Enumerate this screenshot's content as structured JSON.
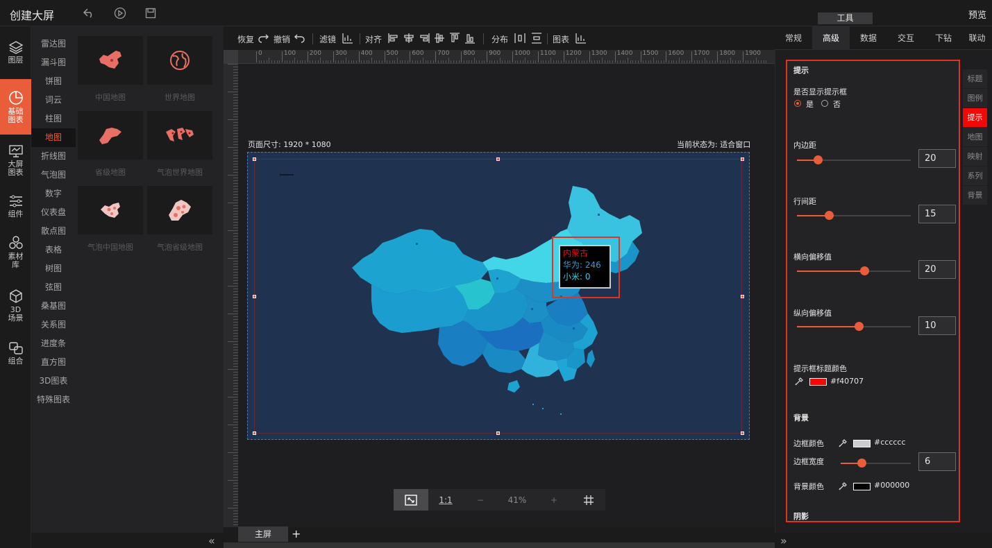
{
  "app": {
    "title": "创建大屏",
    "preview": "预览",
    "tools_label": "工具"
  },
  "iconbar": [
    {
      "label": "图层"
    },
    {
      "label": "基础\n图表"
    },
    {
      "label": "大屏\n图表"
    },
    {
      "label": "组件"
    },
    {
      "label": "素材\n库"
    },
    {
      "label": "3D\n场景"
    },
    {
      "label": "组合"
    }
  ],
  "categories": [
    "雷达图",
    "漏斗图",
    "饼图",
    "词云",
    "柱图",
    "地图",
    "折线图",
    "气泡图",
    "数字",
    "仪表盘",
    "散点图",
    "表格",
    "树图",
    "弦图",
    "桑基图",
    "关系图",
    "进度条",
    "直方图",
    "3D图表",
    "特殊图表"
  ],
  "active_category": "地图",
  "thumbs": [
    {
      "label": "中国地图"
    },
    {
      "label": "世界地图"
    },
    {
      "label": "省级地图"
    },
    {
      "label": "气泡世界地图"
    },
    {
      "label": "气泡中国地图"
    },
    {
      "label": "气泡省级地图"
    }
  ],
  "toolbar": {
    "restore": "恢复",
    "undo": "撤销",
    "filter": "滤镜",
    "align": "对齐",
    "distribute": "分布",
    "chart": "图表"
  },
  "ruler": {
    "ticks": [
      "0",
      "100",
      "200",
      "300",
      "400",
      "500",
      "600",
      "700",
      "800",
      "900",
      "1000",
      "1100",
      "1200",
      "1300",
      "1400",
      "1500",
      "1600",
      "1700",
      "1800",
      "1900"
    ]
  },
  "canvas": {
    "page_size": "页面尺寸: 1920 * 1080",
    "page_state": "当前状态为: 适合窗口"
  },
  "tooltip": {
    "title": "内蒙古",
    "lines": [
      "华为: 246",
      "小米: 0"
    ],
    "title_color": "#f40707"
  },
  "zoom": {
    "ratio": "1:1",
    "minus": "−",
    "value": "41%",
    "plus": "+"
  },
  "tabs": {
    "main": "主屏",
    "add": "+"
  },
  "right_tabs": [
    "常规",
    "高级",
    "数据",
    "交互",
    "下钻",
    "联动"
  ],
  "active_right_tab": "高级",
  "sub_tabs": [
    "标题",
    "图例",
    "提示",
    "地图",
    "映射",
    "系列",
    "背景"
  ],
  "active_sub_tab": "提示",
  "props": {
    "section_tip": "提示",
    "show_tip_label": "是否显示提示框",
    "yes": "是",
    "no": "否",
    "padding_label": "内边距",
    "padding": "20",
    "padding_pos": 0.18,
    "line_spacing_label": "行间距",
    "line_spacing": "15",
    "line_spacing_pos": 0.28,
    "x_offset_label": "横向偏移值",
    "x_offset": "20",
    "x_offset_pos": 0.59,
    "y_offset_label": "纵向偏移值",
    "y_offset": "10",
    "y_offset_pos": 0.54,
    "title_color_label": "提示框标题颜色",
    "title_color": "#f40707",
    "section_bg": "背景",
    "border_color_label": "边框颜色",
    "border_color": "#cccccc",
    "border_width_label": "边框宽度",
    "border_width": "6",
    "border_width_pos": 0.3,
    "bg_color_label": "背景颜色",
    "bg_color": "#000000",
    "section_shadow": "阴影"
  },
  "colors": {
    "accent": "#ea5d3a",
    "highlight": "#e3331f",
    "map_bg": "#1f3350"
  }
}
